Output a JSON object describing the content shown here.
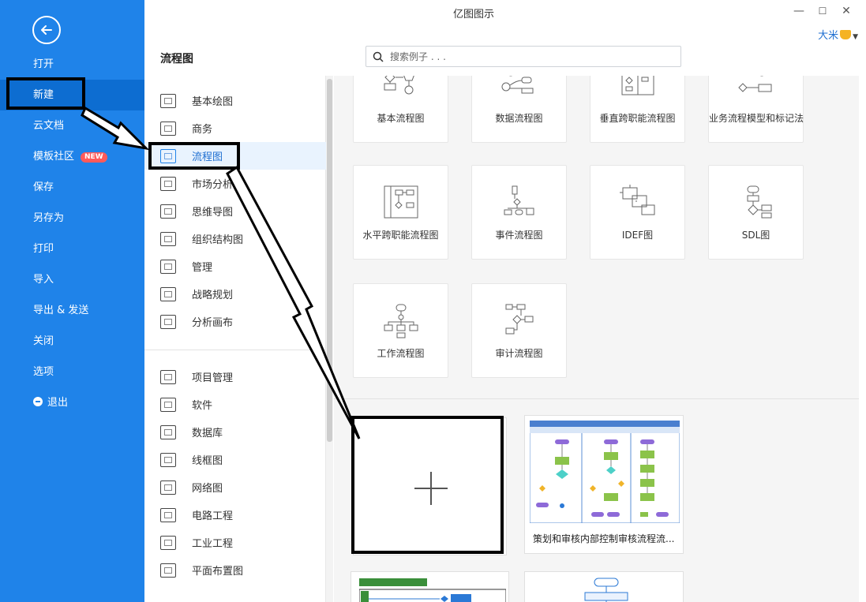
{
  "window": {
    "title": "亿图图示",
    "controls": [
      "—",
      "☐",
      "✕"
    ],
    "user": "大米"
  },
  "left_nav": {
    "items": [
      {
        "label": "打开"
      },
      {
        "label": "新建"
      },
      {
        "label": "云文档"
      },
      {
        "label": "模板社区",
        "badge": "NEW"
      },
      {
        "label": "保存"
      },
      {
        "label": "另存为"
      },
      {
        "label": "打印"
      },
      {
        "label": "导入"
      },
      {
        "label": "导出 & 发送"
      },
      {
        "label": "关闭"
      },
      {
        "label": "选项"
      },
      {
        "label": "退出"
      }
    ]
  },
  "header": {
    "title": "流程图",
    "search_placeholder": "搜索例子 . . ."
  },
  "categories": [
    {
      "label": "基本绘图",
      "icon": "shapes-icon"
    },
    {
      "label": "商务",
      "icon": "briefcase-icon"
    },
    {
      "label": "流程图",
      "icon": "flowchart-icon"
    },
    {
      "label": "市场分析",
      "icon": "bar-chart-icon"
    },
    {
      "label": "思维导图",
      "icon": "mindmap-icon"
    },
    {
      "label": "组织结构图",
      "icon": "org-chart-icon"
    },
    {
      "label": "管理",
      "icon": "gear-people-icon"
    },
    {
      "label": "战略规划",
      "icon": "strategy-icon"
    },
    {
      "label": "分析画布",
      "icon": "canvas-icon"
    },
    {
      "label": "项目管理",
      "icon": "project-icon"
    },
    {
      "label": "软件",
      "icon": "software-icon"
    },
    {
      "label": "数据库",
      "icon": "database-icon"
    },
    {
      "label": "线框图",
      "icon": "wireframe-icon"
    },
    {
      "label": "网络图",
      "icon": "network-icon"
    },
    {
      "label": "电路工程",
      "icon": "circuit-icon"
    },
    {
      "label": "工业工程",
      "icon": "industrial-icon"
    },
    {
      "label": "平面布置图",
      "icon": "floorplan-icon"
    }
  ],
  "template_types": [
    {
      "label": "基本流程图"
    },
    {
      "label": "数据流程图"
    },
    {
      "label": "垂直跨职能流程图"
    },
    {
      "label": "业务流程模型和标记法"
    },
    {
      "label": "水平跨职能流程图"
    },
    {
      "label": "事件流程图"
    },
    {
      "label": "IDEF图"
    },
    {
      "label": "SDL图"
    },
    {
      "label": "工作流程图"
    },
    {
      "label": "审计流程图"
    }
  ],
  "examples": [
    {
      "caption": "策划和审核内部控制审核流程流..."
    }
  ],
  "colors": {
    "sidebar": "#1f83e9",
    "accent": "#1f6fd1",
    "badge": "#ff5a5a"
  }
}
